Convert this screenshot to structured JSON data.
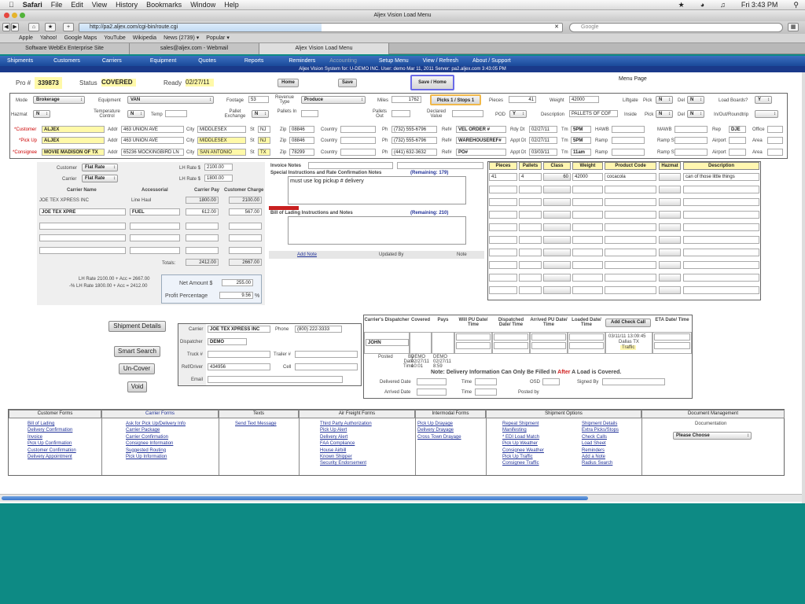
{
  "mac": {
    "menu": [
      "Safari",
      "File",
      "Edit",
      "View",
      "History",
      "Bookmarks",
      "Window",
      "Help"
    ],
    "clock": "Fri 3:43 PM"
  },
  "window": {
    "title": "Aljex Vision Load Menu"
  },
  "browser": {
    "url": "http://pa2.aljex.com/cgi-bin/route.cgi",
    "search_placeholder": "Google",
    "bookmarks": [
      "Apple",
      "Yahoo!",
      "Google Maps",
      "YouTube",
      "Wikipedia",
      "News (2739) ▾",
      "Popular ▾"
    ],
    "tabs": [
      "Software WebEx Enterprise Site",
      "sales@aljex.com - Webmail",
      "Aljex Vision Load Menu"
    ]
  },
  "nav": [
    "Shipments",
    "Customers",
    "Carriers",
    "Equipment",
    "Quotes",
    "Reports",
    "Reminders",
    "Accounting",
    "Setup Menu",
    "View / Refresh",
    "About / Support"
  ],
  "info": "Aljex Vision System for: U-DEMO INC.   User: demo   Mar 11, 2011   Server: pa2.aljex.com   3:43:05 PM",
  "header": {
    "pro_label": "Pro #",
    "pro": "339873",
    "status_label": "Status",
    "status": "COVERED",
    "ready_label": "Ready",
    "ready": "02/27/11",
    "home": "Home",
    "save": "Save",
    "save_home": "Save / Home",
    "menu_page": "Menu Page"
  },
  "row1": {
    "mode_l": "Mode",
    "mode": "Brokerage",
    "equip_l": "Equipment",
    "equip": "VAN",
    "footage_l": "Footage",
    "footage": "53",
    "rev_l": "Revenue Type",
    "rev": "Produce",
    "miles_l": "Miles",
    "miles": "1762",
    "picks": "Picks 1 / Stops 1",
    "pieces_l": "Pieces",
    "pieces": "41",
    "weight_l": "Weight",
    "weight": "42000",
    "liftgate": "Liftgate",
    "pick": "Pick",
    "del": "Del",
    "n": "N",
    "y": "Y",
    "loadboards": "Load Boards?"
  },
  "row2": {
    "hazmat_l": "Hazmat",
    "temp_l": "Temperature Control",
    "temp2": "Temp",
    "pallet_l": "Pallet Exchange",
    "pallets_in": "Pallets In",
    "pallets_out": "Pallets Out",
    "declared": "Declared Value",
    "pod": "POD",
    "desc_l": "Description",
    "desc": "PALLETS OF COF",
    "inside": "Inside",
    "inout": "In/Out/Roundtrip"
  },
  "stops": [
    {
      "type": "*Customer",
      "name": "ALJEX",
      "addr": "463 UNION AVE",
      "city": "MIDDLESEX",
      "st": "NJ",
      "zip": "08846",
      "ph": "(732) 555-6796",
      "ref": "VEL ORDER #",
      "dt_l": "Rdy Dt",
      "dt": "02/27/11",
      "tm": "5PM",
      "x1": "HAWB",
      "x2": "MAWB",
      "x3": "Rep",
      "x3v": "DJE",
      "x4": "Office"
    },
    {
      "type": "*Pick Up",
      "name": "ALJEX",
      "addr": "463 UNION AVE",
      "city": "MIDDLESEX",
      "st": "NJ",
      "zip": "08846",
      "ph": "(732) 555-6796",
      "ref": "WAREHOUSEREF#",
      "dt_l": "Appt Dt",
      "dt": "02/27/11",
      "tm": "5PM",
      "x1": "Ramp",
      "x2": "Ramp St",
      "x3": "Airport",
      "x3v": "",
      "x4": "Area"
    },
    {
      "type": "*Consignee",
      "name": "MOVIE MADISON OF TX",
      "addr": "65236 MOCKINGBIRD LN",
      "city": "SAN ANTONIO",
      "st": "TX",
      "zip": "78299",
      "ph": "(441) 632-3632",
      "ref": "PO#",
      "dt_l": "Appt Dt",
      "dt": "03/03/11",
      "tm": "11am",
      "x1": "Ramp",
      "x2": "Ramp St",
      "x3": "Airport",
      "x3v": "",
      "x4": "Area"
    }
  ],
  "stop_labels": {
    "addr": "Addr",
    "city": "City",
    "st": "St",
    "zip": "Zip",
    "country": "Country",
    "ph": "Ph",
    "ref": "Ref#",
    "tm": "Tm"
  },
  "rates": {
    "customer_l": "Customer",
    "carrier_l": "Carrier",
    "flat": "Flat Rate",
    "lh_l": "LH Rate $",
    "lh1": "2100.00",
    "lh2": "1800.00",
    "cols": [
      "Carrier Name",
      "Accessorial",
      "Carrier Pay",
      "Customer Charge"
    ],
    "r1": [
      "JOE TEX XPRESS INC",
      "Line Haul",
      "1800.00",
      "2100.00"
    ],
    "r2": [
      "JOE TEX XPRE",
      "FUEL",
      "612.00",
      "567.00"
    ],
    "totals_l": "Totals:",
    "tot_pay": "2412.00",
    "tot_charge": "2667.00",
    "note1": "LH Rate 2100.00 + Acc = 2667.00",
    "note2": "-% LH Rate 1800.00 + Acc = 2412.00",
    "net_l": "Net Amount $",
    "net": "255.00",
    "pp_l": "Profit Percentage",
    "pp": "9.56",
    "pct": "%"
  },
  "notes": {
    "invoice": "Invoice Notes",
    "special": "Special Instructions and Rate Confirmation Notes",
    "rem1": "(Remaining: 179)",
    "text": "must use log pickup # delivery",
    "bol": "Bill of Lading Instructions and Notes",
    "rem2": "(Remaining: 210)",
    "add": "Add Note",
    "updated": "Updated By",
    "note": "Note"
  },
  "items": {
    "cols": [
      "Pieces",
      "Pallets",
      "Class",
      "Weight",
      "Product Code",
      "Hazmat",
      "Description"
    ],
    "row": [
      "41",
      "4",
      "60",
      "42000",
      "cocacola",
      "",
      "can of those little things"
    ]
  },
  "left_btns": [
    "Shipment Details",
    "Smart Search",
    "Un-Cover",
    "Void"
  ],
  "carrier": {
    "carrier_l": "Carrier",
    "carrier": "JOE TEX XPRESS INC",
    "phone_l": "Phone",
    "phone": "(800) 222-3333",
    "disp_l": "Dispatcher",
    "disp": "DEMO",
    "truck_l": "Truck #",
    "trailer_l": "Trailer #",
    "ref_l": "Ref/Driver",
    "ref": "434956",
    "cell_l": "Cell",
    "email_l": "Email"
  },
  "track": {
    "cols": [
      "Carrier's Dispatcher",
      "Covered",
      "Pays",
      "Will PU Date/ Time",
      "Dispatched Date/ Time",
      "Arrived PU Date/ Time",
      "Loaded Date/ Time",
      "Add Check Call",
      "ETA Date/ Time"
    ],
    "dispatcher": "JOHN",
    "posted": "Posted",
    "by": "By",
    "date": "Date",
    "time": "Time",
    "pv1": "DEMO",
    "pv2": "02/27/11",
    "pv3": "10:01",
    "cv1": "DEMO",
    "cv2": "02/27/11",
    "cv3": "8:59",
    "check": "03/11/11 13:09:45",
    "city": "Dallas TX",
    "traffic": "Traffic",
    "note": "Note:  Delivery Information Can Only Be Filled In After A Load is Covered.",
    "after": "After",
    "delivered": "Delivered Date",
    "arrived": "Arrived Date",
    "time_l": "Time",
    "osd": "OSD",
    "signed": "Signed By",
    "postedby": "Posted by"
  },
  "forms": {
    "headers": [
      "Customer Forms",
      "Carrier Forms",
      "Texts",
      "Air Freight Forms",
      "Intermodal Forms",
      "Shipment Options",
      "Document Management"
    ],
    "customer": [
      "Bill of Lading",
      "Delivery Confirmation",
      "Invoice",
      "Pick Up Confirmation",
      "Customer Confirmation",
      "Delivery Appointment"
    ],
    "carrier": [
      "Ask for Pick Up/Delivery Info",
      "Carrier Package",
      "Carrier Confirmation",
      "Consignee Information",
      "Suggested Routing",
      "Pick Up Information"
    ],
    "texts": [
      "Send Text Message"
    ],
    "air": [
      "Third Party Authorization",
      "Pick Up Alert",
      "Delivery Alert",
      "FAA Compliance",
      "House Airbill",
      "Known Shipper",
      "Security Endorsement"
    ],
    "inter": [
      "Pick Up Drayage",
      "Delivery Drayage",
      "Cross Town Drayage"
    ],
    "ship1": [
      "Repeat Shipment",
      "Manifesting",
      "* EDI Load Match",
      "Pick Up Weather",
      "Consignee Weather",
      "Pick Up Traffic",
      "Consignee Traffic"
    ],
    "ship2": [
      "Shipment Details",
      "Extra Picks/Stops",
      "Check Calls",
      "Load Sheet",
      "Reminders",
      "Add a Note",
      "Radius Search"
    ],
    "doc_l": "Documentation",
    "doc_sel": "Please Choose"
  }
}
